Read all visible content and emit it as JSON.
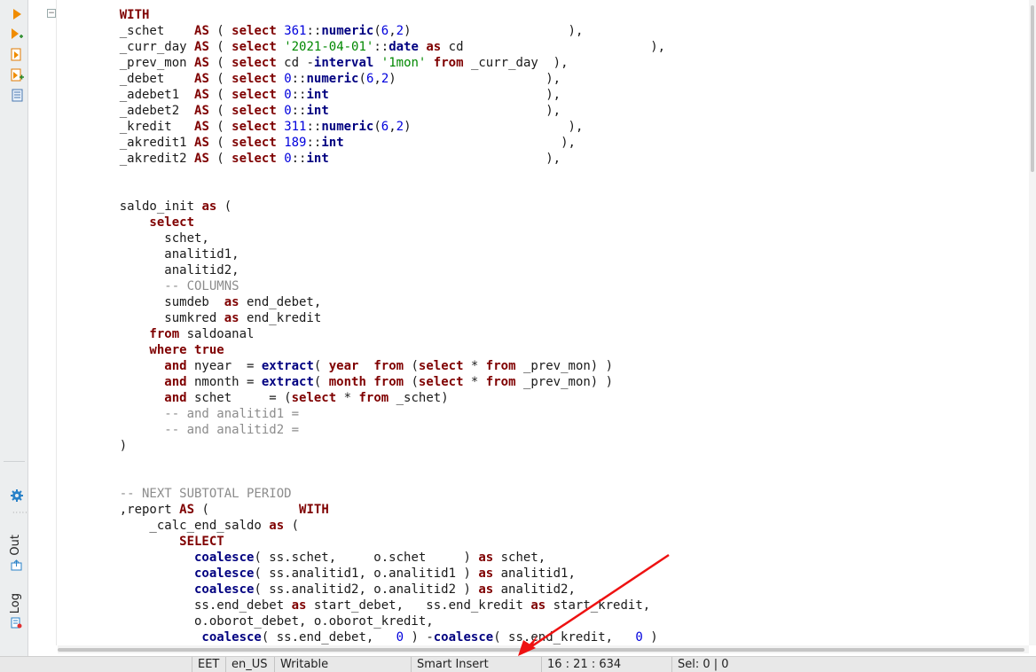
{
  "tool_strip": {
    "icons": [
      "run-icon",
      "run-step-icon",
      "script-icon",
      "script-add-icon",
      "plan-icon"
    ],
    "bottom_icons": [
      "settings-icon"
    ],
    "tabs": [
      {
        "label": "Out",
        "icon": "output-icon"
      },
      {
        "label": "Log",
        "icon": "log-icon"
      }
    ]
  },
  "editor": {
    "fold_symbol": "⊖",
    "current_line": 15,
    "lines": [
      [
        [
          "kw",
          "    WITH"
        ]
      ],
      [
        [
          "",
          "    _schet    "
        ],
        [
          "kw",
          "AS"
        ],
        [
          "",
          " ( "
        ],
        [
          "kw",
          "select"
        ],
        [
          "",
          " "
        ],
        [
          "num",
          "361"
        ],
        [
          "",
          "::"
        ],
        [
          "fn",
          "numeric"
        ],
        [
          "",
          "("
        ],
        [
          "num",
          "6"
        ],
        [
          "",
          ","
        ],
        [
          "num",
          "2"
        ],
        [
          "",
          ")                     ),"
        ]
      ],
      [
        [
          "",
          "    _curr_day "
        ],
        [
          "kw",
          "AS"
        ],
        [
          "",
          " ( "
        ],
        [
          "kw",
          "select"
        ],
        [
          "",
          " "
        ],
        [
          "str",
          "'2021-04-01'"
        ],
        [
          "",
          "::"
        ],
        [
          "fn",
          "date"
        ],
        [
          "",
          " "
        ],
        [
          "kw",
          "as"
        ],
        [
          "",
          " cd                         ),"
        ]
      ],
      [
        [
          "",
          "    _prev_mon "
        ],
        [
          "kw",
          "AS"
        ],
        [
          "",
          " ( "
        ],
        [
          "kw",
          "select"
        ],
        [
          "",
          " cd -"
        ],
        [
          "fn",
          "interval"
        ],
        [
          "",
          " "
        ],
        [
          "str",
          "'1mon'"
        ],
        [
          "",
          " "
        ],
        [
          "kw",
          "from"
        ],
        [
          "",
          " _curr_day  ),"
        ]
      ],
      [
        [
          "",
          "    _debet    "
        ],
        [
          "kw",
          "AS"
        ],
        [
          "",
          " ( "
        ],
        [
          "kw",
          "select"
        ],
        [
          "",
          " "
        ],
        [
          "num",
          "0"
        ],
        [
          "",
          "::"
        ],
        [
          "fn",
          "numeric"
        ],
        [
          "",
          "("
        ],
        [
          "num",
          "6"
        ],
        [
          "",
          ","
        ],
        [
          "num",
          "2"
        ],
        [
          "",
          ")                    ),"
        ]
      ],
      [
        [
          "",
          "    _adebet1  "
        ],
        [
          "kw",
          "AS"
        ],
        [
          "",
          " ( "
        ],
        [
          "kw",
          "select"
        ],
        [
          "",
          " "
        ],
        [
          "num",
          "0"
        ],
        [
          "",
          "::"
        ],
        [
          "fn",
          "int"
        ],
        [
          "",
          "                             ),"
        ]
      ],
      [
        [
          "",
          "    _adebet2  "
        ],
        [
          "kw",
          "AS"
        ],
        [
          "",
          " ( "
        ],
        [
          "kw",
          "select"
        ],
        [
          "",
          " "
        ],
        [
          "num",
          "0"
        ],
        [
          "",
          "::"
        ],
        [
          "fn",
          "int"
        ],
        [
          "",
          "                             ),"
        ]
      ],
      [
        [
          "",
          "    _kredit   "
        ],
        [
          "kw",
          "AS"
        ],
        [
          "",
          " ( "
        ],
        [
          "kw",
          "select"
        ],
        [
          "",
          " "
        ],
        [
          "num",
          "311"
        ],
        [
          "",
          "::"
        ],
        [
          "fn",
          "numeric"
        ],
        [
          "",
          "("
        ],
        [
          "num",
          "6"
        ],
        [
          "",
          ","
        ],
        [
          "num",
          "2"
        ],
        [
          "",
          ")                     ),"
        ]
      ],
      [
        [
          "",
          "    _akredit1 "
        ],
        [
          "kw",
          "AS"
        ],
        [
          "",
          " ( "
        ],
        [
          "kw",
          "select"
        ],
        [
          "",
          " "
        ],
        [
          "num",
          "189"
        ],
        [
          "",
          "::"
        ],
        [
          "fn",
          "int"
        ],
        [
          "",
          "                             ),"
        ]
      ],
      [
        [
          "",
          "    _akredit2 "
        ],
        [
          "kw",
          "AS"
        ],
        [
          "",
          " ( "
        ],
        [
          "kw",
          "select"
        ],
        [
          "",
          " "
        ],
        [
          "num",
          "0"
        ],
        [
          "",
          "::"
        ],
        [
          "fn",
          "int"
        ],
        [
          "",
          "                             ),"
        ]
      ],
      [
        [
          "",
          ""
        ]
      ],
      [
        [
          "",
          ""
        ]
      ],
      [
        [
          "",
          "    saldo_init "
        ],
        [
          "kw",
          "as"
        ],
        [
          "",
          " ("
        ]
      ],
      [
        [
          "kw",
          "        select"
        ]
      ],
      [
        [
          "",
          "          schet,"
        ]
      ],
      [
        [
          "",
          "          analitid1,"
        ]
      ],
      [
        [
          "",
          "          analitid2,"
        ]
      ],
      [
        [
          "cm",
          "          -- COLUMNS"
        ]
      ],
      [
        [
          "",
          "          sumdeb  "
        ],
        [
          "kw",
          "as"
        ],
        [
          "",
          " end_debet,"
        ]
      ],
      [
        [
          "",
          "          sumkred "
        ],
        [
          "kw",
          "as"
        ],
        [
          "",
          " end_kredit"
        ]
      ],
      [
        [
          "kw",
          "        from"
        ],
        [
          "",
          " saldoanal"
        ]
      ],
      [
        [
          "kw",
          "        where"
        ],
        [
          "",
          " "
        ],
        [
          "kw",
          "true"
        ]
      ],
      [
        [
          "kw",
          "          and"
        ],
        [
          "",
          " nyear  = "
        ],
        [
          "fn",
          "extract"
        ],
        [
          "",
          "( "
        ],
        [
          "kw",
          "year"
        ],
        [
          "",
          " "
        ],
        [
          "kw",
          " from"
        ],
        [
          "",
          " ("
        ],
        [
          "kw",
          "select"
        ],
        [
          "",
          " * "
        ],
        [
          "kw",
          "from"
        ],
        [
          "",
          " _prev_mon) )"
        ]
      ],
      [
        [
          "kw",
          "          and"
        ],
        [
          "",
          " nmonth = "
        ],
        [
          "fn",
          "extract"
        ],
        [
          "",
          "( "
        ],
        [
          "kw",
          "month"
        ],
        [
          "",
          " "
        ],
        [
          "kw",
          "from"
        ],
        [
          "",
          " ("
        ],
        [
          "kw",
          "select"
        ],
        [
          "",
          " * "
        ],
        [
          "kw",
          "from"
        ],
        [
          "",
          " _prev_mon) )"
        ]
      ],
      [
        [
          "kw",
          "          and"
        ],
        [
          "",
          " schet     = ("
        ],
        [
          "kw",
          "select"
        ],
        [
          "",
          " * "
        ],
        [
          "kw",
          "from"
        ],
        [
          "",
          " _schet)"
        ]
      ],
      [
        [
          "cm",
          "          -- and analitid1 ="
        ]
      ],
      [
        [
          "cm",
          "          -- and analitid2 ="
        ]
      ],
      [
        [
          "",
          "    )"
        ]
      ],
      [
        [
          "",
          ""
        ]
      ],
      [
        [
          "",
          ""
        ]
      ],
      [
        [
          "cm",
          "    -- NEXT SUBTOTAL PERIOD"
        ]
      ],
      [
        [
          "",
          "    ,report "
        ],
        [
          "kw",
          "AS"
        ],
        [
          "",
          " (            "
        ],
        [
          "kw",
          "WITH"
        ]
      ],
      [
        [
          "",
          "        _calc_end_saldo "
        ],
        [
          "kw",
          "as"
        ],
        [
          "",
          " ("
        ]
      ],
      [
        [
          "kw",
          "            SELECT"
        ]
      ],
      [
        [
          "fn",
          "              coalesce"
        ],
        [
          "",
          "( ss.schet,     o.schet     ) "
        ],
        [
          "kw",
          "as"
        ],
        [
          "",
          " schet,"
        ]
      ],
      [
        [
          "fn",
          "              coalesce"
        ],
        [
          "",
          "( ss.analitid1, o.analitid1 ) "
        ],
        [
          "kw",
          "as"
        ],
        [
          "",
          " analitid1,"
        ]
      ],
      [
        [
          "fn",
          "              coalesce"
        ],
        [
          "",
          "( ss.analitid2, o.analitid2 ) "
        ],
        [
          "kw",
          "as"
        ],
        [
          "",
          " analitid2,"
        ]
      ],
      [
        [
          "",
          "              ss.end_debet "
        ],
        [
          "kw",
          "as"
        ],
        [
          "",
          " start_debet,   ss.end_kredit "
        ],
        [
          "kw",
          "as"
        ],
        [
          "",
          " start_kredit,"
        ]
      ],
      [
        [
          "",
          "              o.oborot_debet, o.oborot_kredit,"
        ]
      ],
      [
        [
          "fn",
          "               coalesce"
        ],
        [
          "",
          "( ss.end_debet,   "
        ],
        [
          "num",
          "0"
        ],
        [
          "",
          " ) -"
        ],
        [
          "fn",
          "coalesce"
        ],
        [
          "",
          "( ss.end_kredit,   "
        ],
        [
          "num",
          "0"
        ],
        [
          "",
          " )"
        ]
      ]
    ]
  },
  "status": {
    "timezone": "EET",
    "locale": "en_US",
    "mode": "Writable",
    "insert_mode": "Smart Insert",
    "position": "16 : 21 : 634",
    "selection": "Sel: 0 | 0"
  },
  "colors": {
    "keyword": "#7f0000",
    "function": "#000080",
    "number": "#0000dd",
    "string": "#008800",
    "comment": "#8c8c8c",
    "current_line": "#e8f2fe",
    "annotation_arrow": "#ee1111"
  }
}
